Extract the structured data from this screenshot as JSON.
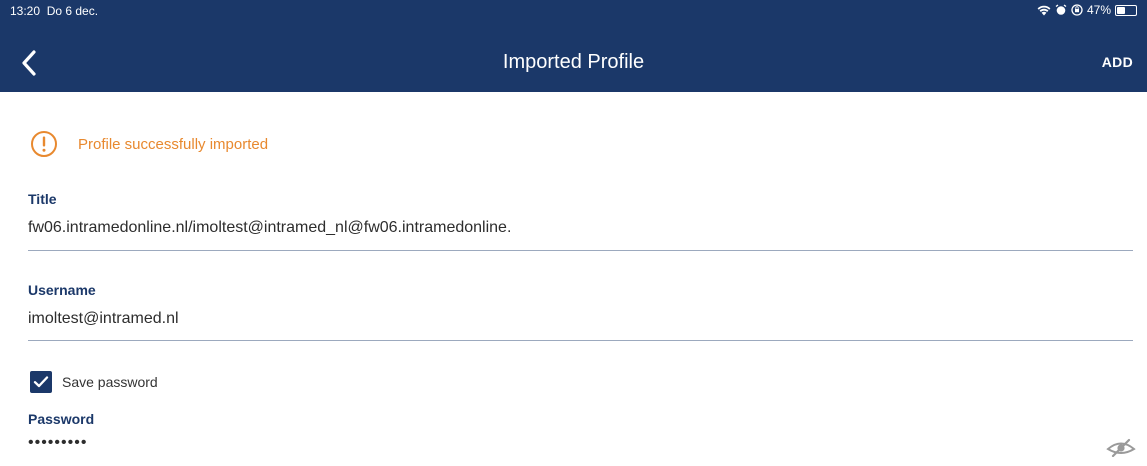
{
  "status_bar": {
    "time": "13:20",
    "date": "Do 6 dec.",
    "battery_text": "47%",
    "battery_level": 0.47
  },
  "nav": {
    "title": "Imported Profile",
    "add_label": "ADD",
    "back_icon": "chevron-left-icon"
  },
  "notice": {
    "text": "Profile successfully imported",
    "icon": "info-icon",
    "color": "#e8892f"
  },
  "fields": {
    "title": {
      "label": "Title",
      "value": "fw06.intramedonline.nl/imoltest@intramed_nl@fw06.intramedonline."
    },
    "username": {
      "label": "Username",
      "value": "imoltest@intramed.nl"
    },
    "save_password": {
      "label": "Save password",
      "checked": true
    },
    "password": {
      "label": "Password",
      "value": "•••••••••",
      "toggle_icon": "eye-hidden-icon"
    }
  },
  "colors": {
    "brand": "#1b3869",
    "accent": "#e8892f"
  }
}
